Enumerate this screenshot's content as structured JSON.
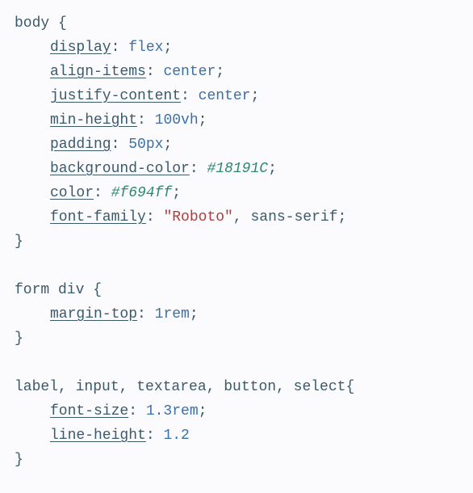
{
  "rules": [
    {
      "selector": "body",
      "decls": [
        {
          "prop": "display",
          "value": [
            {
              "t": "flex",
              "c": "num"
            }
          ]
        },
        {
          "prop": "align-items",
          "value": [
            {
              "t": "center",
              "c": "num"
            }
          ]
        },
        {
          "prop": "justify-content",
          "value": [
            {
              "t": "center",
              "c": "num"
            }
          ]
        },
        {
          "prop": "min-height",
          "value": [
            {
              "t": "100vh",
              "c": "num"
            }
          ]
        },
        {
          "prop": "padding",
          "value": [
            {
              "t": "50px",
              "c": "num"
            }
          ]
        },
        {
          "prop": "background-color",
          "value": [
            {
              "t": "#18191C",
              "c": "hex"
            }
          ]
        },
        {
          "prop": "color",
          "value": [
            {
              "t": "#f694ff",
              "c": "hex"
            }
          ]
        },
        {
          "prop": "font-family",
          "value": [
            {
              "t": "\"Roboto\"",
              "c": "str"
            },
            {
              "t": ", ",
              "c": "plain"
            },
            {
              "t": "sans-serif",
              "c": "plain"
            }
          ]
        }
      ]
    },
    {
      "selector": "form div",
      "decls": [
        {
          "prop": "margin-top",
          "value": [
            {
              "t": "1rem",
              "c": "num"
            }
          ]
        }
      ]
    },
    {
      "selector": "label, input, textarea, button, select",
      "decls": [
        {
          "prop": "font-size",
          "value": [
            {
              "t": "1.3rem",
              "c": "num"
            }
          ]
        },
        {
          "prop": "line-height",
          "value": [
            {
              "t": "1.2",
              "c": "num"
            }
          ],
          "nosemi": true
        }
      ]
    }
  ]
}
